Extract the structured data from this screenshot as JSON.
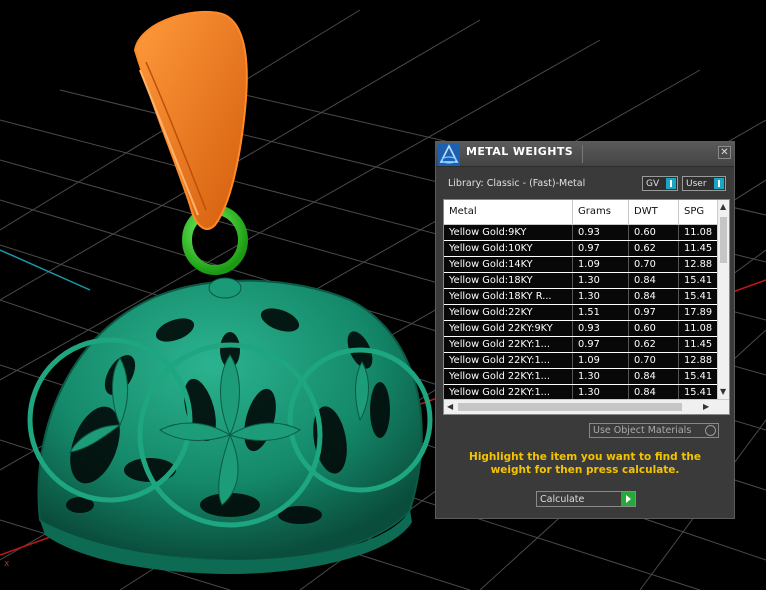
{
  "viewport": {
    "axis_marker": "x",
    "colors": {
      "background": "#000000",
      "grid": "#4a4a4a",
      "pendant": "#14896a",
      "bail": "#f07a1e",
      "jump_ring": "#2ad11e",
      "axis_red": "#c01818",
      "axis_cyan": "#1a9aa8"
    }
  },
  "panel": {
    "title": "METAL WEIGHTS",
    "close_icon": "close-icon",
    "library_label": "Library: Classic - (Fast)-Metal",
    "gv_label": "GV",
    "user_label": "User",
    "columns": [
      "Metal",
      "Grams",
      "DWT",
      "SPG"
    ],
    "rows": [
      {
        "metal": "Yellow Gold:9KY",
        "grams": "0.93",
        "dwt": "0.60",
        "spg": "11.08"
      },
      {
        "metal": "Yellow Gold:10KY",
        "grams": "0.97",
        "dwt": "0.62",
        "spg": "11.45"
      },
      {
        "metal": "Yellow Gold:14KY",
        "grams": "1.09",
        "dwt": "0.70",
        "spg": "12.88"
      },
      {
        "metal": "Yellow Gold:18KY",
        "grams": "1.30",
        "dwt": "0.84",
        "spg": "15.41"
      },
      {
        "metal": "Yellow Gold:18KY R...",
        "grams": "1.30",
        "dwt": "0.84",
        "spg": "15.41"
      },
      {
        "metal": "Yellow Gold:22KY",
        "grams": "1.51",
        "dwt": "0.97",
        "spg": "17.89"
      },
      {
        "metal": "Yellow Gold 22KY:9KY",
        "grams": "0.93",
        "dwt": "0.60",
        "spg": "11.08"
      },
      {
        "metal": "Yellow Gold 22KY:1...",
        "grams": "0.97",
        "dwt": "0.62",
        "spg": "11.45"
      },
      {
        "metal": "Yellow Gold 22KY:1...",
        "grams": "1.09",
        "dwt": "0.70",
        "spg": "12.88"
      },
      {
        "metal": "Yellow Gold 22KY:1...",
        "grams": "1.30",
        "dwt": "0.84",
        "spg": "15.41"
      },
      {
        "metal": "Yellow Gold 22KY:1...",
        "grams": "1.30",
        "dwt": "0.84",
        "spg": "15.41"
      }
    ],
    "use_object_materials": "Use Object Materials",
    "hint": "Highlight the item you want to find the weight for then press calculate.",
    "calculate_label": "Calculate",
    "accent_color": "#f5c400",
    "toggle_color": "#19a7c0",
    "go_color": "#27a83a"
  }
}
